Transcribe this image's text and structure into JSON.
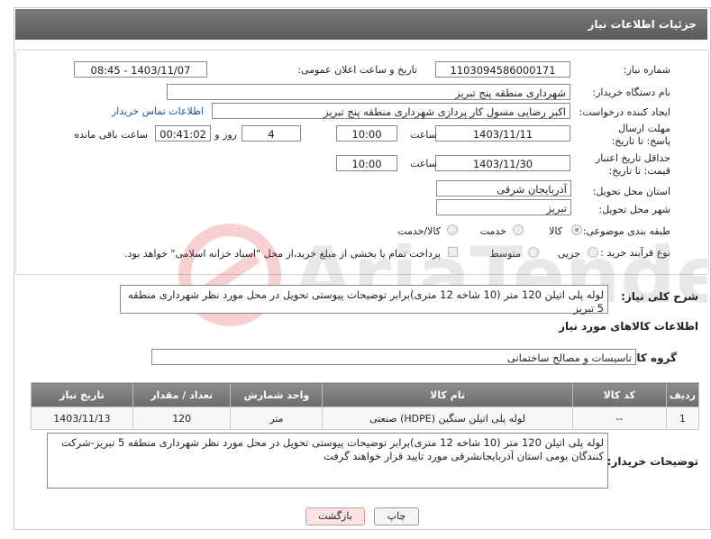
{
  "header": {
    "title": "جزئیات اطلاعات نیاز"
  },
  "form": {
    "need_number_label": "شماره نیاز:",
    "need_number": "1103094586000171",
    "announce_label": "تاریخ و ساعت اعلان عمومی:",
    "announce_value": "1403/11/07 - 08:45",
    "buyer_org_label": "نام دستگاه خریدار:",
    "buyer_org": "شهرداری منطقه پنج تبریز",
    "creator_label": "ایجاد کننده درخواست:",
    "creator": "اکبر رضایی مسول کار پردازی شهرداری منطقه پنج تبریز",
    "contact_link": "اطلاعات تماس خریدار",
    "deadline_label": "مهلت ارسال پاسخ: تا تاریخ:",
    "deadline_date": "1403/11/11",
    "time_label": "ساعت",
    "deadline_time": "10:00",
    "days_value": "4",
    "days_label": "روز و",
    "remaining_time": "00:41:02",
    "remaining_label": "ساعت باقی مانده",
    "validity_label": "حداقل تاریخ اعتبار قیمت: تا تاریخ:",
    "validity_date": "1403/11/30",
    "validity_time": "10:00",
    "province_label": "استان محل تحویل:",
    "province": "آذربایجان شرقی",
    "city_label": "شهر محل تحویل:",
    "city": "تبریز",
    "category_label": "طبقه بندی موضوعی:",
    "category_options": [
      "کالا",
      "خدمت",
      "کالا/خدمت"
    ],
    "process_label": "نوع فرآیند خرید :",
    "process_options": [
      "جزیی",
      "متوسط"
    ],
    "payment_note": "پرداخت تمام یا بخشی از مبلغ خرید،از محل \"اسناد خزانه اسلامی\" خواهد بود."
  },
  "description": {
    "label": "شرح کلی نیاز:",
    "text": "لوله پلی اتیلن 120 متر (10 شاخه 12 متری)برابر توضیحات پیوستی تحویل در محل مورد نظر شهرداری منطقه 5 تبریز"
  },
  "goods_section": {
    "title": "اطلاعات کالاهای مورد نیاز",
    "group_label": "گروه کالا:",
    "group_value": "تاسیسات و مصالح ساختمانی"
  },
  "table": {
    "headers": [
      "ردیف",
      "کد کالا",
      "نام کالا",
      "واحد شمارش",
      "تعداد / مقدار",
      "تاریخ نیاز"
    ],
    "rows": [
      [
        "1",
        "--",
        "لوله پلی اتیلن سنگین (HDPE) صنعتی",
        "متر",
        "120",
        "1403/11/13"
      ]
    ]
  },
  "buyer_notes": {
    "label": "توضیحات خریدار:",
    "text": "لوله پلی اتیلن 120 متر (10 شاخه 12 متری)برابر توضیحات پیوستی تحویل در محل مورد نظر شهرداری منطقه 5 تبریز-شرکت کنندگان بومی استان آذربایجانشرقی مورد تایید قرار خواهند گرفت"
  },
  "buttons": {
    "print": "چاپ",
    "back": "بازگشت"
  }
}
